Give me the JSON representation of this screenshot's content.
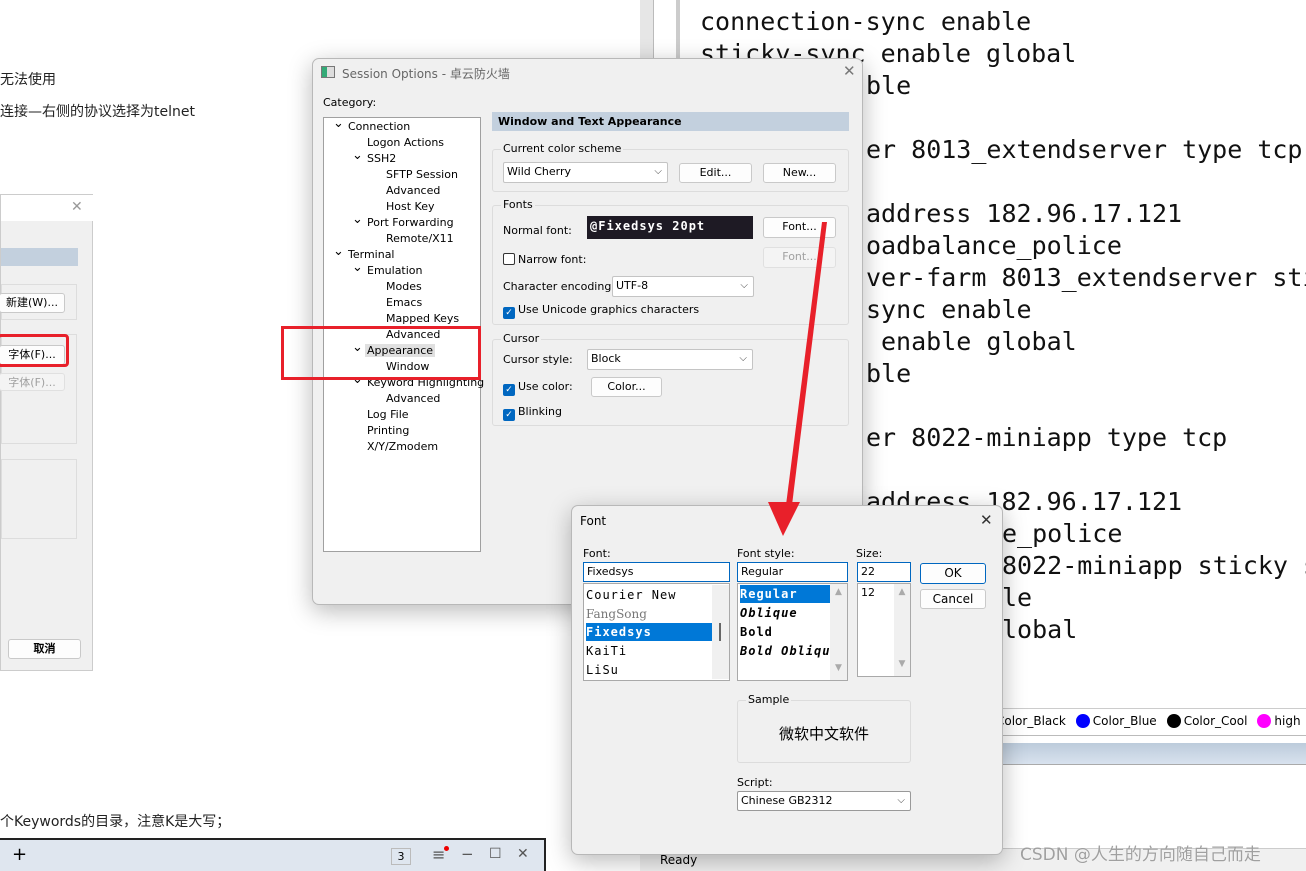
{
  "document": {
    "line1": "无法使用",
    "line2": "连接—右侧的协议选择为telnet",
    "line3": "个Keywords的目录，注意K是大写；"
  },
  "left_dialog": {
    "new_button": "新建(W)...",
    "font_button": "字体(F)...",
    "narrow_font_button": "字体(F)...",
    "cancel_button": "取消"
  },
  "left_taskbar": {
    "add": "+",
    "count": "3",
    "menu": "≡",
    "minimize": "−",
    "maximize": "☐",
    "close": "✕"
  },
  "terminal": {
    "lines": [
      "connection-sync enable",
      "sticky-sync enable global",
      "ble",
      "er 8013_extendserver type tcp",
      "address 182.96.17.121",
      "oadbalance_police",
      "ver-farm 8013_extendserver sti",
      "sync enable",
      "enable global",
      "ble",
      "er 8022-miniapp type tcp",
      "address 182.96.17.121",
      "e_police",
      "8022-miniapp sticky s",
      "le",
      "lobal"
    ],
    "color_bar": [
      {
        "name": "Color_Black",
        "color": ""
      },
      {
        "name": "Color_Blue",
        "color": "#0000ff"
      },
      {
        "name": "Color_Cool",
        "color": "#000000"
      },
      {
        "name": "high",
        "color": "#ff00ff"
      }
    ],
    "status": "Ready",
    "watermark": "CSDN @人生的方向随自己而走"
  },
  "session_options": {
    "title": "Session Options - 卓云防火墙",
    "category_label": "Category:",
    "tree": [
      {
        "label": "Connection",
        "level": 0,
        "expanded": true
      },
      {
        "label": "Logon Actions",
        "level": 1
      },
      {
        "label": "SSH2",
        "level": 1,
        "expanded": true
      },
      {
        "label": "SFTP Session",
        "level": 2
      },
      {
        "label": "Advanced",
        "level": 2
      },
      {
        "label": "Host Key",
        "level": 2
      },
      {
        "label": "Port Forwarding",
        "level": 1,
        "expanded": true
      },
      {
        "label": "Remote/X11",
        "level": 2
      },
      {
        "label": "Terminal",
        "level": 0,
        "expanded": true
      },
      {
        "label": "Emulation",
        "level": 1,
        "expanded": true
      },
      {
        "label": "Modes",
        "level": 2
      },
      {
        "label": "Emacs",
        "level": 2
      },
      {
        "label": "Mapped Keys",
        "level": 2
      },
      {
        "label": "Advanced",
        "level": 2
      },
      {
        "label": "Appearance",
        "level": 1,
        "expanded": true,
        "selected": true
      },
      {
        "label": "Window",
        "level": 2
      },
      {
        "label": "Keyword Highlighting",
        "level": 1,
        "expanded": true
      },
      {
        "label": "Advanced",
        "level": 2
      },
      {
        "label": "Log File",
        "level": 1
      },
      {
        "label": "Printing",
        "level": 1
      },
      {
        "label": "X/Y/Zmodem",
        "level": 1
      }
    ],
    "header": "Window and Text Appearance",
    "color_scheme": {
      "label": "Current color scheme",
      "value": "Wild Cherry",
      "edit": "Edit...",
      "new": "New..."
    },
    "fonts": {
      "label": "Fonts",
      "normal_label": "Normal font:",
      "normal_value": "@Fixedsys 20pt",
      "font_button": "Font...",
      "narrow_label": "Narrow font:",
      "narrow_checked": false,
      "narrow_button": "Font...",
      "encoding_label": "Character encoding:",
      "encoding_value": "UTF-8",
      "unicode_label": "Use Unicode graphics characters",
      "unicode_checked": true
    },
    "cursor": {
      "label": "Cursor",
      "style_label": "Cursor style:",
      "style_value": "Block",
      "use_color_label": "Use color:",
      "use_color_checked": true,
      "color_button": "Color...",
      "blinking_label": "Blinking",
      "blinking_checked": true
    }
  },
  "font_dialog": {
    "title": "Font",
    "font_label": "Font:",
    "font_value": "Fixedsys",
    "fonts": [
      "Courier New",
      "FangSong",
      "Fixedsys",
      "KaiTi",
      "LiSu"
    ],
    "selected_font": "Fixedsys",
    "style_label": "Font style:",
    "style_value": "Regular",
    "styles": [
      "Regular",
      "Oblique",
      "Bold",
      "Bold Oblique"
    ],
    "size_label": "Size:",
    "size_value": "22",
    "sizes": [
      "12"
    ],
    "ok": "OK",
    "cancel": "Cancel",
    "sample_label": "Sample",
    "sample_text": "微软中文软件",
    "script_label": "Script:",
    "script_value": "Chinese GB2312"
  },
  "colors": {
    "annotation_red": "#e8202a",
    "selection_blue": "#0078d7",
    "header_bg": "#c3d0de"
  }
}
